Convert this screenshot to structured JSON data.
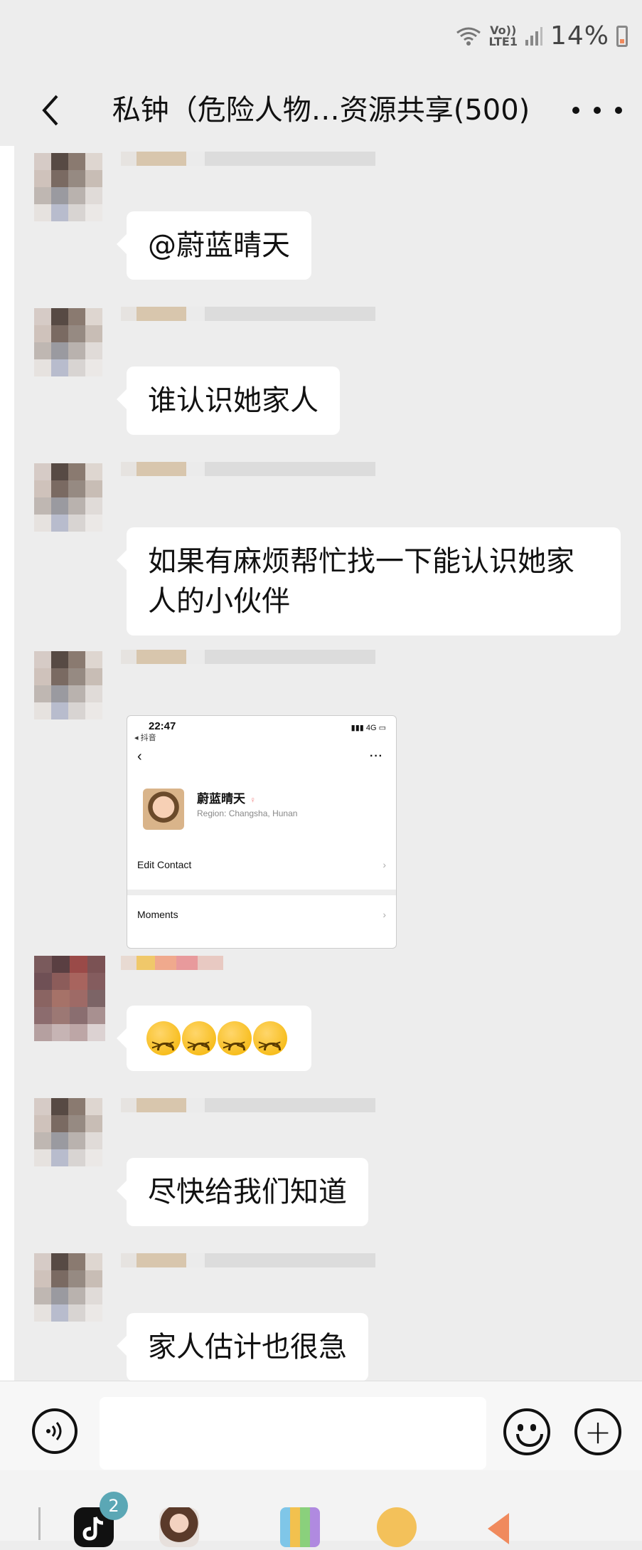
{
  "status_bar": {
    "network": "Vo))\nLTE1",
    "battery_pct": "14%",
    "icons": [
      "wifi-icon",
      "signal-icon",
      "battery-icon"
    ]
  },
  "nav": {
    "title": "私钟（危险人物…资源共享(500)",
    "back_icon": "chevron-left-icon",
    "more_icon": "more-icon"
  },
  "messages": [
    {
      "type": "text",
      "text": "@蔚蓝晴天"
    },
    {
      "type": "text",
      "text": "谁认识她家人"
    },
    {
      "type": "text",
      "text": "如果有麻烦帮忙找一下能认识她家人的小伙伴"
    },
    {
      "type": "image",
      "shot": {
        "time": "22:47",
        "app": "◂ 抖音",
        "signal": "4G",
        "name": "蔚蓝晴天",
        "region": "Region: Changsha, Hunan",
        "edit_contact": "Edit Contact",
        "moments": "Moments"
      }
    },
    {
      "type": "emoji",
      "emoji_names": [
        "angry-crying-emoji",
        "angry-crying-emoji",
        "angry-crying-emoji",
        "angry-crying-emoji"
      ]
    },
    {
      "type": "text",
      "text": "尽快给我们知道"
    },
    {
      "type": "text",
      "text": "家人估计也很急"
    }
  ],
  "input_bar": {
    "value": "",
    "icons": [
      "voice-icon",
      "emoji-icon",
      "plus-icon"
    ]
  },
  "dock": {
    "badge": "2",
    "apps": [
      "tiktok-app-icon",
      "game-avatar-app-icon",
      "colorful-app-icon",
      "bear-app-icon",
      "orange-arrow-app-icon"
    ]
  },
  "colors": {
    "background": "#ededed",
    "bubble": "#ffffff",
    "accent_badge": "#5ba7b5"
  }
}
